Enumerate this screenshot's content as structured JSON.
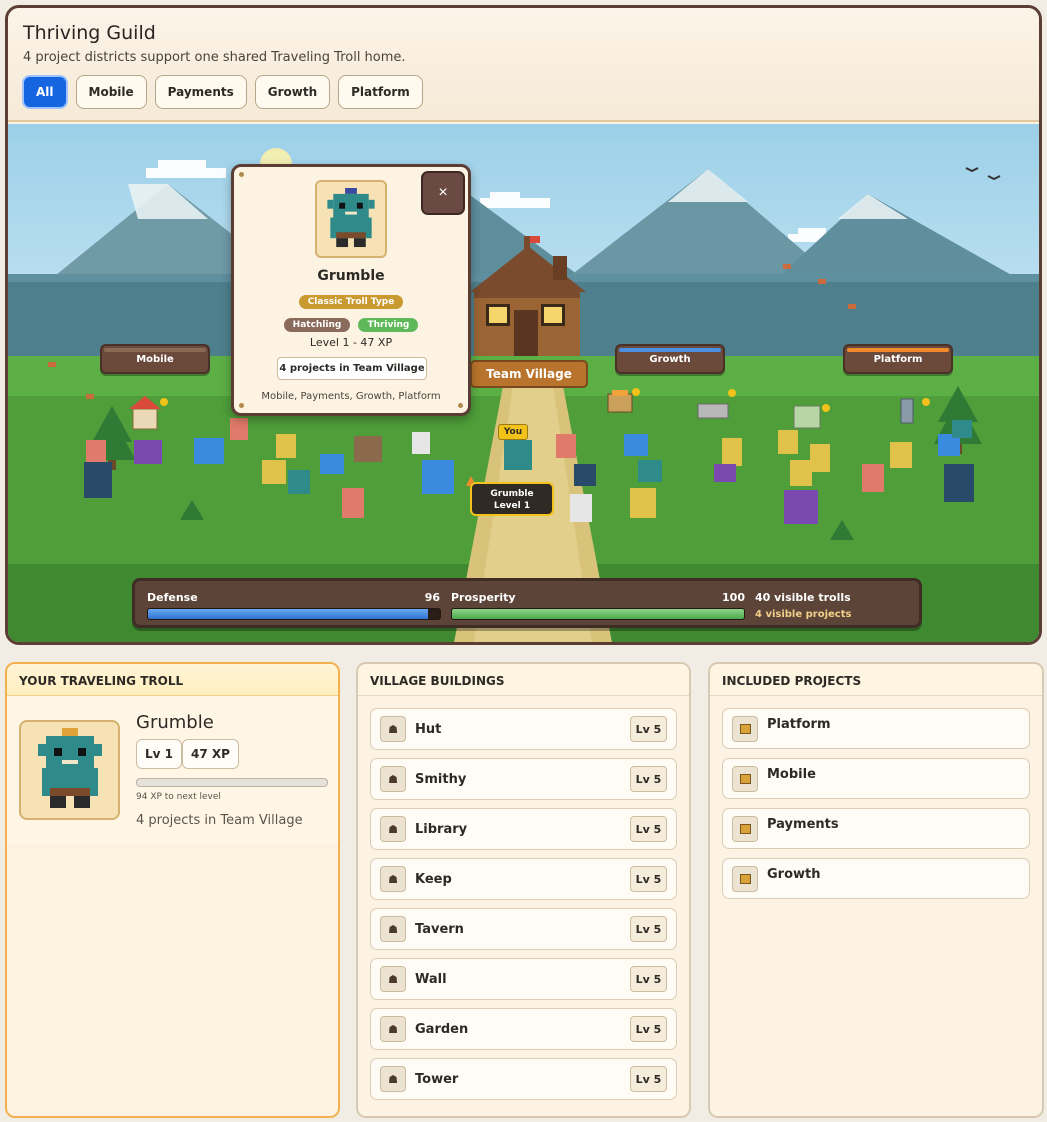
{
  "header": {
    "title": "Thriving Guild",
    "subtitle": "4 project districts support one shared Traveling Troll home."
  },
  "filters": [
    {
      "label": "All",
      "active": true
    },
    {
      "label": "Mobile",
      "active": false
    },
    {
      "label": "Payments",
      "active": false
    },
    {
      "label": "Growth",
      "active": false
    },
    {
      "label": "Platform",
      "active": false
    }
  ],
  "scene": {
    "districts": [
      {
        "label": "Mobile",
        "accent": "#8a6a55"
      },
      {
        "label": "Growth",
        "accent": "#4a8fe0"
      },
      {
        "label": "Platform",
        "accent": "#f08a2a"
      }
    ],
    "center_label": "Team Village",
    "you_tag": "You",
    "player_tag": {
      "name": "Grumble",
      "level": "Level 1"
    }
  },
  "popup": {
    "close_label": "×",
    "name": "Grumble",
    "type_badge": "Classic Troll Type",
    "tags": [
      "Hatchling",
      "Thriving"
    ],
    "level_line": "Level 1 - 47 XP",
    "projects_summary": "4 projects in Team Village",
    "projects_list": "Mobile, Payments, Growth, Platform"
  },
  "stats": {
    "defense_label": "Defense",
    "defense_value": "96",
    "defense_fraction": 0.96,
    "prosperity_label": "Prosperity",
    "prosperity_value": "100",
    "prosperity_fraction": 1.0,
    "trolls_text": "40 visible trolls",
    "projects_text": "4 visible projects"
  },
  "troll_card": {
    "heading": "YOUR TRAVELING TROLL",
    "name": "Grumble",
    "level_chip": "Lv 1",
    "xp_chip": "47 XP",
    "xp_progress": 0.0,
    "xp_note": "94 XP to next level",
    "projects_text": "4 projects in Team Village"
  },
  "buildings_card": {
    "heading": "VILLAGE BUILDINGS",
    "items": [
      {
        "label": "Hut",
        "level": "Lv 5"
      },
      {
        "label": "Smithy",
        "level": "Lv 5"
      },
      {
        "label": "Library",
        "level": "Lv 5"
      },
      {
        "label": "Keep",
        "level": "Lv 5"
      },
      {
        "label": "Tavern",
        "level": "Lv 5"
      },
      {
        "label": "Wall",
        "level": "Lv 5"
      },
      {
        "label": "Garden",
        "level": "Lv 5"
      },
      {
        "label": "Tower",
        "level": "Lv 5"
      }
    ]
  },
  "projects_card": {
    "heading": "INCLUDED PROJECTS",
    "items": [
      {
        "label": "Platform"
      },
      {
        "label": "Mobile"
      },
      {
        "label": "Payments"
      },
      {
        "label": "Growth"
      }
    ]
  },
  "colors": {
    "accent_blue": "#1565e0",
    "defense_bar": "#3f8be0",
    "prosperity_bar": "#6cc06a",
    "gold": "#f2c21b"
  }
}
